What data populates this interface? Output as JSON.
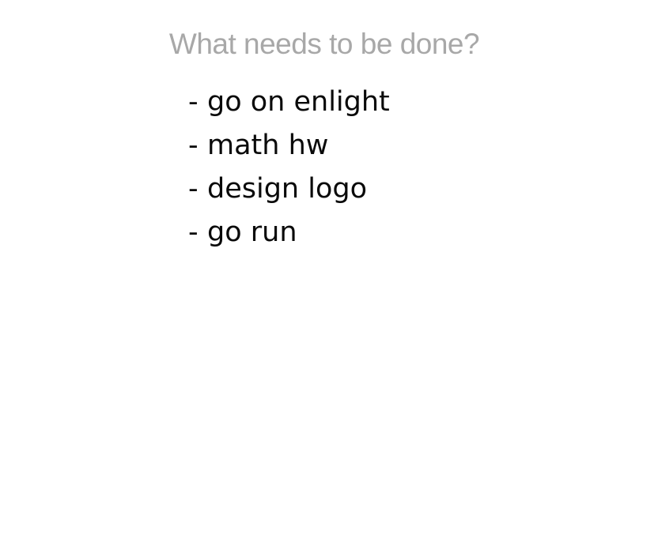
{
  "prompt": {
    "text": "What needs to be done?"
  },
  "todos": {
    "dash": "-",
    "items": [
      {
        "text": "go on enlight"
      },
      {
        "text": "math hw"
      },
      {
        "text": "design logo"
      },
      {
        "text": "go run"
      }
    ]
  },
  "colors": {
    "prompt_text": "#a8a8a8",
    "item_text": "#0a0a0a",
    "background": "#ffffff"
  }
}
